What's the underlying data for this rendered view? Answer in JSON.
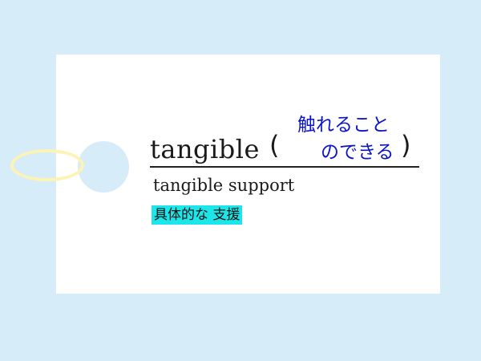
{
  "card": {
    "word": "tangible",
    "paren_open": "(",
    "paren_close": ")",
    "meaning_line1": "触れること",
    "meaning_line2": "のできる",
    "phrase_en": "tangible support",
    "phrase_ja": "具体的な 支援"
  },
  "colors": {
    "background": "#d6ecf8",
    "card": "#ffffff",
    "meaning_text": "#0a14c8",
    "highlight": "#1ce6ea",
    "ring": "#fbf4b4"
  }
}
